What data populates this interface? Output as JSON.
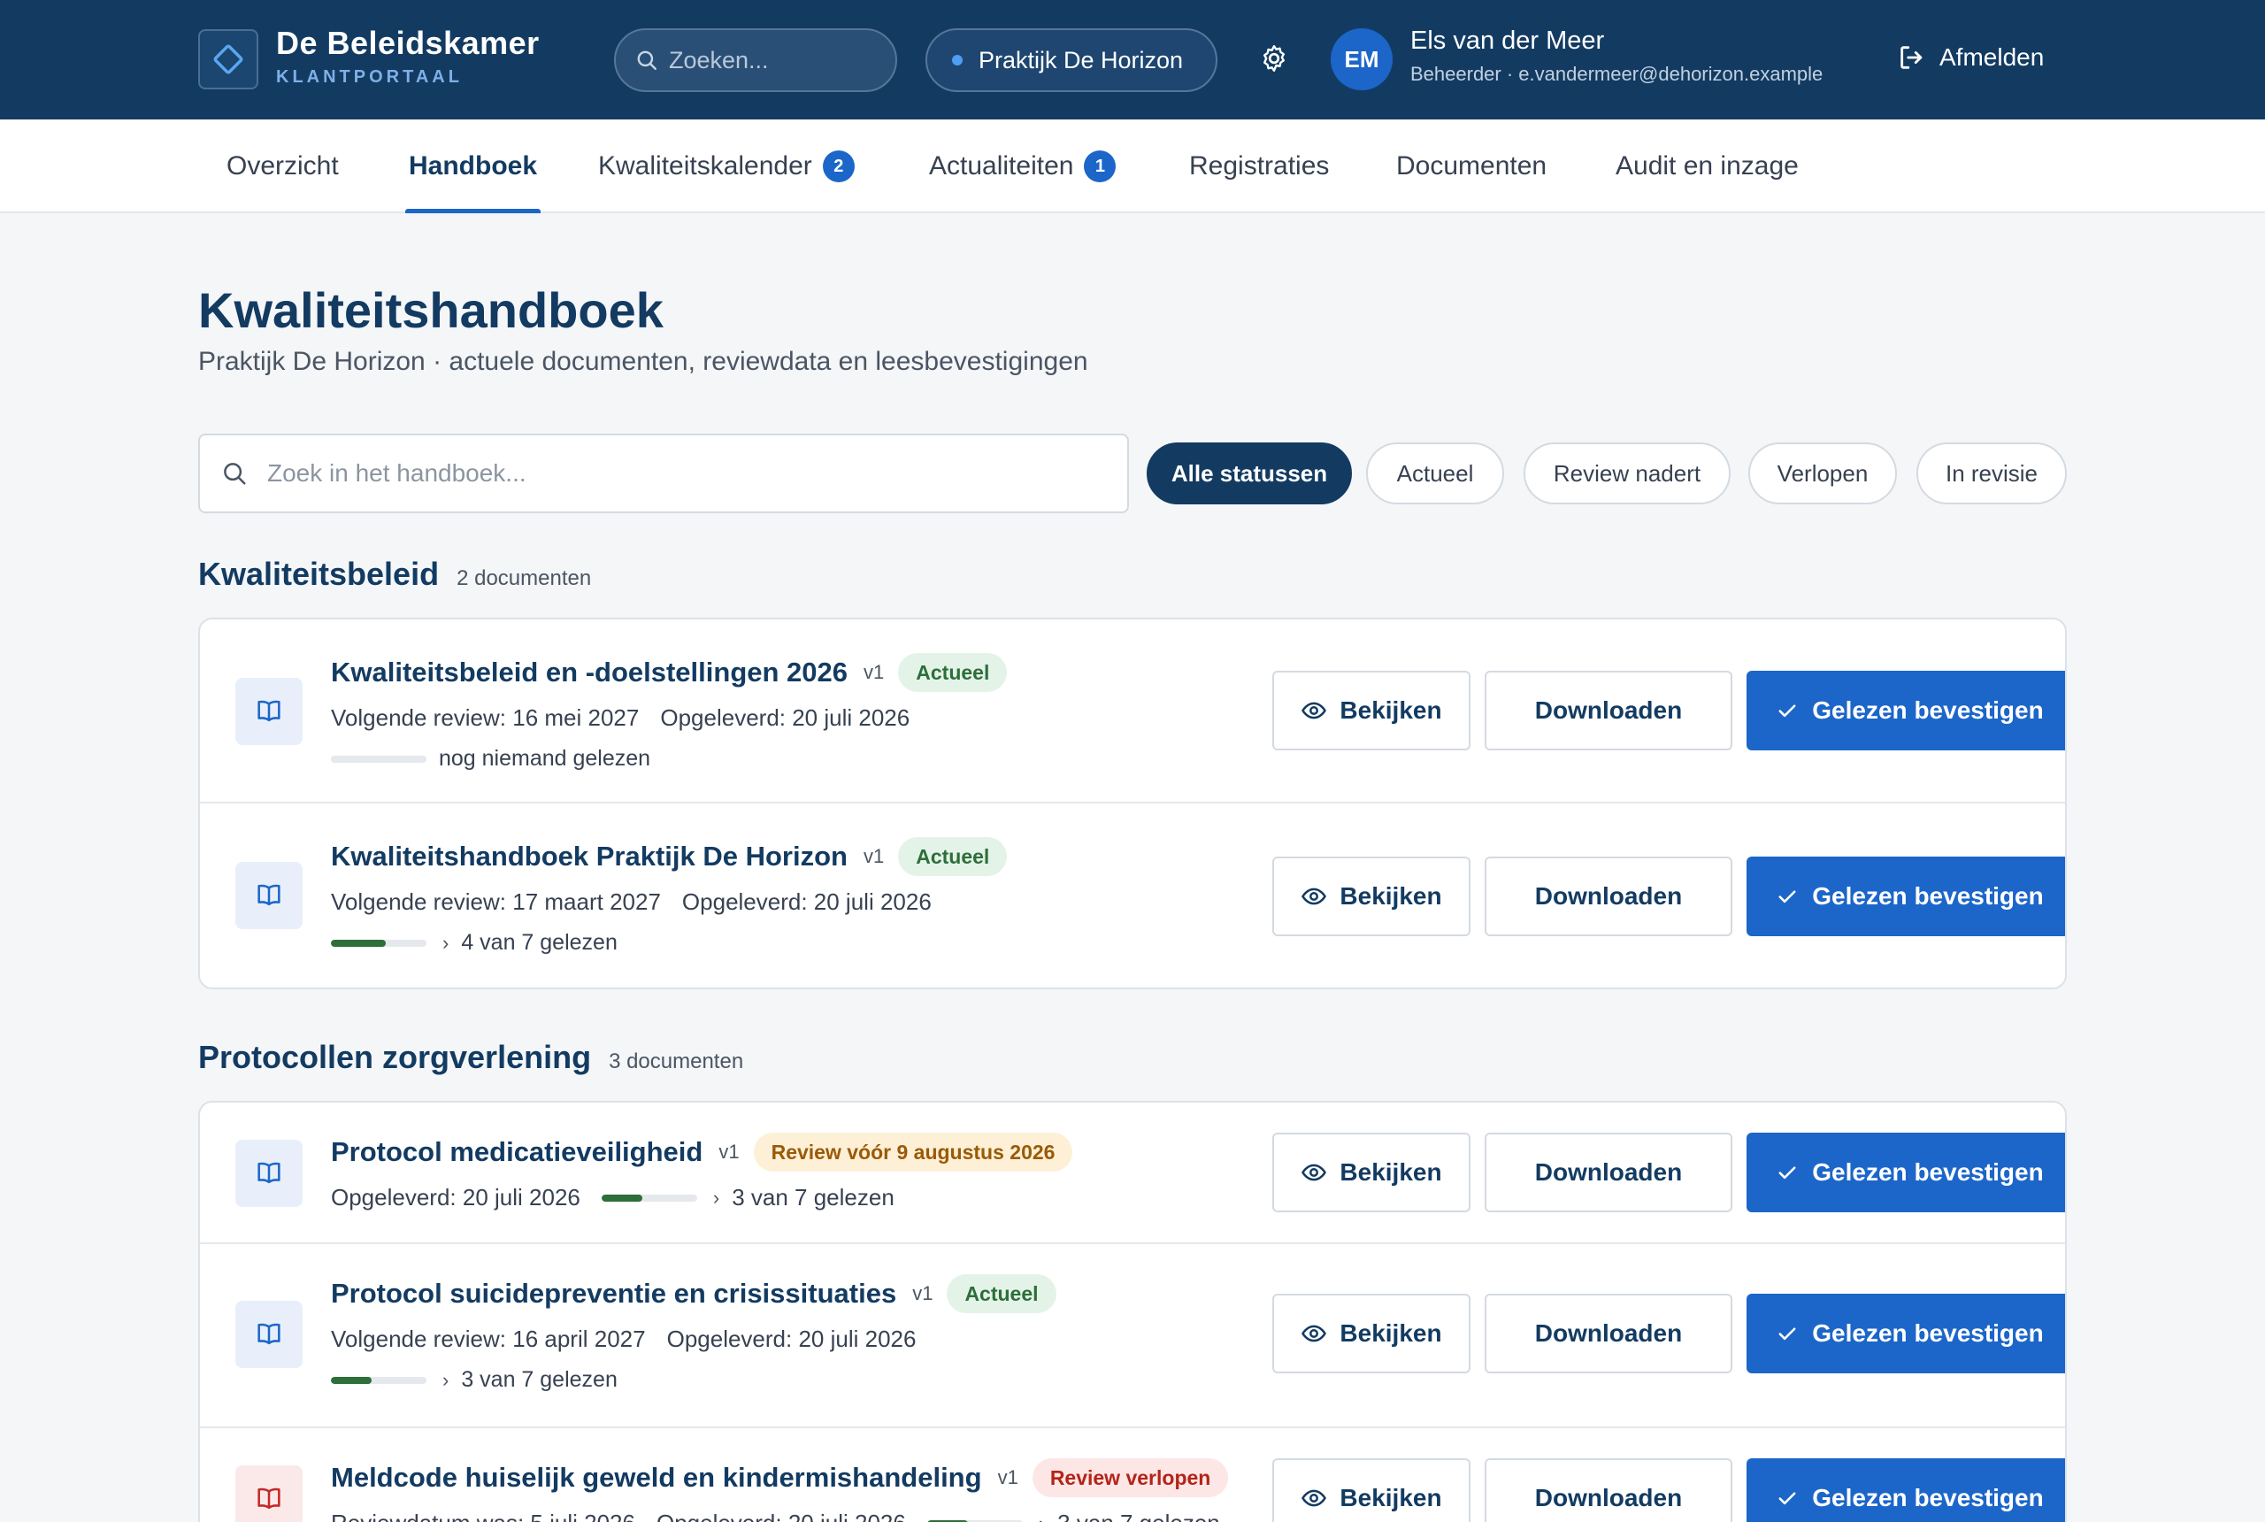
{
  "header": {
    "brand_name": "De Beleidskamer",
    "brand_sub": "KLANTPORTAAL",
    "search_placeholder": "Zoeken...",
    "practice": "Praktijk De Horizon",
    "avatar_initials": "EM",
    "user_name": "Els van der Meer",
    "user_role": "Beheerder · e.vandermeer@dehorizon.example",
    "logout_label": "Afmelden"
  },
  "nav": {
    "tabs": [
      {
        "label": "Overzicht"
      },
      {
        "label": "Handboek"
      },
      {
        "label": "Kwaliteitskalender",
        "badge": "2"
      },
      {
        "label": "Actualiteiten",
        "badge": "1"
      },
      {
        "label": "Registraties"
      },
      {
        "label": "Documenten"
      },
      {
        "label": "Audit en inzage"
      }
    ],
    "active": "Handboek"
  },
  "page": {
    "title": "Kwaliteitshandboek",
    "subtitle": "Praktijk De Horizon · actuele documenten, reviewdata en leesbevestigingen",
    "search_placeholder": "Zoek in het handboek..."
  },
  "filters": [
    "Alle statussen",
    "Actueel",
    "Review nadert",
    "Verlopen",
    "In revisie"
  ],
  "actions": {
    "view": "Bekijken",
    "download": "Downloaden",
    "confirm": "Gelezen bevestigen"
  },
  "sections": [
    {
      "title": "Kwaliteitsbeleid",
      "count": "2 documenten",
      "docs": [
        {
          "title": "Kwaliteitsbeleid en -doelstellingen 2026",
          "version": "v1",
          "status": "Actueel",
          "review": "Volgende review: 16 mei 2027",
          "delivered": "Opgeleverd: 20 juli 2026",
          "read_text": "nog niemand gelezen",
          "read_fraction": 0
        },
        {
          "title": "Kwaliteitshandboek Praktijk De Horizon",
          "version": "v1",
          "status": "Actueel",
          "review": "Volgende review: 17 maart 2027",
          "delivered": "Opgeleverd: 20 juli 2026",
          "read_text": "4 van 7 gelezen",
          "read_fraction": 0.57
        }
      ]
    },
    {
      "title": "Protocollen zorgverlening",
      "count": "3 documenten",
      "docs": [
        {
          "title": "Protocol medicatieveiligheid",
          "version": "v1",
          "status": "Review vóór 9 augustus 2026",
          "delivered": "Opgeleverd: 20 juli 2026",
          "read_text": "3 van 7 gelezen",
          "read_fraction": 0.43
        },
        {
          "title": "Protocol suicidepreventie en crisissituaties",
          "version": "v1",
          "status": "Actueel",
          "review": "Volgende review: 16 april 2027",
          "delivered": "Opgeleverd: 20 juli 2026",
          "read_text": "3 van 7 gelezen",
          "read_fraction": 0.43
        },
        {
          "title": "Meldcode huiselijk geweld en kindermishandeling",
          "version": "v1",
          "status": "Review verlopen",
          "review": "Reviewdatum was: 5 juli 2026",
          "delivered": "Opgeleverd: 20 juli 2026",
          "read_text": "3 van 7 gelezen",
          "read_fraction": 0.43
        }
      ]
    }
  ],
  "colors": {
    "header_bg": "#133b62",
    "primary": "#1c66c9",
    "status_current": "#2d6e3a",
    "status_warning": "#9a5a06",
    "status_expired": "#b42318"
  }
}
